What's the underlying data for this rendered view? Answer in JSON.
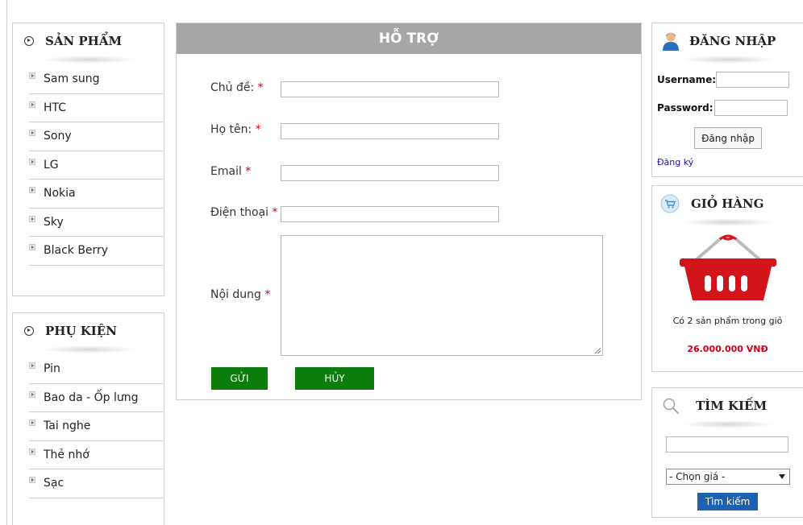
{
  "products_panel": {
    "title": "SẢN PHẨM",
    "items": [
      "Sam sung",
      "HTC",
      "Sony",
      "LG",
      "Nokia",
      "Sky",
      "Black Berry"
    ]
  },
  "accessories_panel": {
    "title": "PHỤ KIỆN",
    "items": [
      "Pin",
      "Bao da - Ốp lưng",
      "Tai nghe",
      "Thẻ nhớ",
      "Sạc"
    ]
  },
  "support_form": {
    "title": "HỖ TRỢ",
    "fields": {
      "topic_label": "Chủ đề:",
      "name_label": "Họ tên:",
      "email_label": "Email",
      "phone_label": "Điện thoại",
      "content_label": "Nội dung",
      "required_mark": "*"
    },
    "submit_label": "GỬI",
    "cancel_label": "HỦY"
  },
  "login_panel": {
    "title": "ĐĂNG NHẬP",
    "username_label": "Username:",
    "password_label": "Password:",
    "login_button": "Đăng nhập",
    "register_link": "Đăng ký"
  },
  "cart_panel": {
    "title": "GIỎ HÀNG",
    "summary": "Có 2 sản phẩm trong giỏ",
    "total": "26.000.000 VNĐ"
  },
  "search_panel": {
    "title": "TÌM KIẾM",
    "price_select_value": "- Chọn giá -",
    "search_button": "Tìm kiếm"
  },
  "colors": {
    "green_button": "#0a7d0a",
    "blue_button": "#1c62b0",
    "price_red": "#d0021b",
    "header_gray": "#a6a6a6"
  },
  "icons": [
    "play-circle-icon",
    "user-icon",
    "cart-icon",
    "basket-icon",
    "search-icon",
    "menu-arrow-icon"
  ]
}
